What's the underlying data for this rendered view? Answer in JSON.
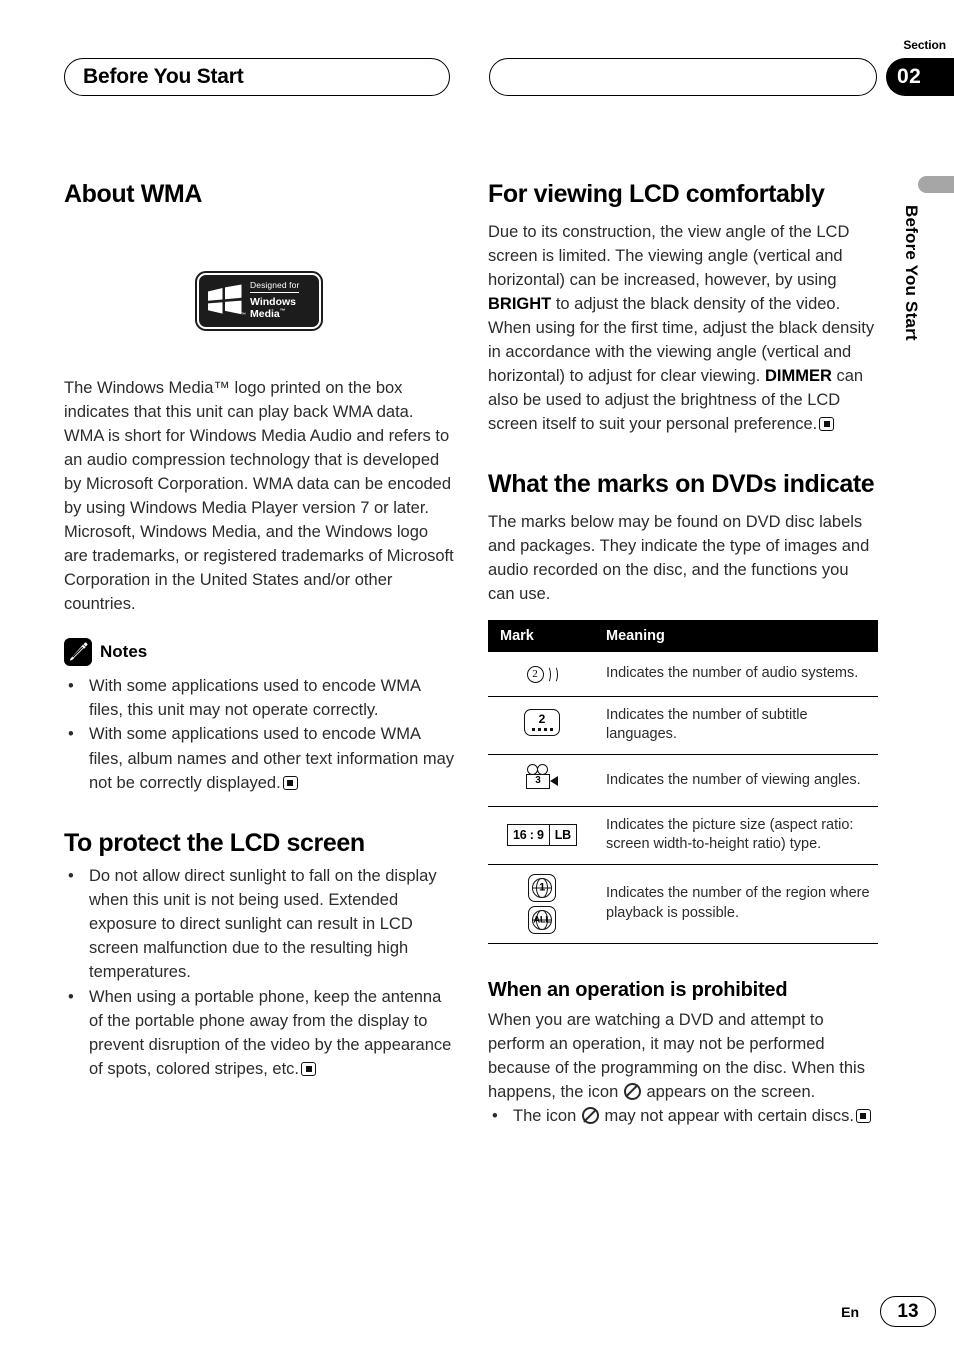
{
  "header": {
    "breadcrumb_title": "Before You Start",
    "section_label": "Section",
    "section_number": "02"
  },
  "sidebar": {
    "vertical_label": "Before You Start"
  },
  "left_column": {
    "about_wma": {
      "heading": "About WMA",
      "logo": {
        "designed_for": "Designed for",
        "line1": "Windows",
        "line2": "Media",
        "tm": "™",
        "flag_tm": "™"
      },
      "paragraphs": [
        "The Windows Media™ logo printed on the box indicates that this unit can play back WMA data.",
        "WMA is short for Windows Media Audio and refers to an audio compression technology that is developed by Microsoft Corporation. WMA data can be encoded by using Windows Media Player version 7 or later.",
        "Microsoft, Windows Media, and the Windows logo are trademarks, or registered trademarks of Microsoft Corporation in the United States and/or other countries."
      ],
      "notes_label": "Notes",
      "notes": [
        "With some applications used to encode WMA files, this unit may not operate correctly.",
        "With some applications used to encode WMA files, album names and other text information may not be correctly displayed."
      ]
    },
    "protect_lcd": {
      "heading": "To protect the LCD screen",
      "bullets": [
        "Do not allow direct sunlight to fall on the display when this unit is not being used. Extended exposure to direct sunlight can result in LCD screen malfunction due to the resulting high temperatures.",
        "When using a portable phone, keep the antenna of the portable phone away from the display to prevent disruption of the video by the appearance of spots, colored stripes, etc."
      ]
    }
  },
  "right_column": {
    "viewing_lcd": {
      "heading": "For viewing LCD comfortably",
      "text_part1": "Due to its construction, the view angle of the LCD screen is limited. The viewing angle (vertical and horizontal) can be increased, however, by using ",
      "keyword1": "BRIGHT",
      "text_part2": " to adjust the black density of the video. When using for the first time, adjust the black density in accordance with the viewing angle (vertical and horizontal) to adjust for clear viewing. ",
      "keyword2": "DIMMER",
      "text_part3": " can also be used to adjust the brightness of the LCD screen itself to suit your personal preference."
    },
    "dvd_marks": {
      "heading": "What the marks on DVDs indicate",
      "intro": "The marks below may be found on DVD disc labels and packages. They indicate the type of images and audio recorded on the disc, and the functions you can use.",
      "table": {
        "columns": [
          "Mark",
          "Meaning"
        ],
        "rows": [
          {
            "icon": "audio-systems-icon",
            "icon_value": "2",
            "meaning": "Indicates the number of audio systems."
          },
          {
            "icon": "subtitle-languages-icon",
            "icon_value": "2",
            "meaning": "Indicates the number of subtitle languages."
          },
          {
            "icon": "viewing-angles-icon",
            "icon_value": "3",
            "meaning": "Indicates the number of viewing angles."
          },
          {
            "icon": "aspect-ratio-icon",
            "icon_value_1": "16 : 9",
            "icon_value_2": "LB",
            "meaning": "Indicates the picture size (aspect ratio: screen width-to-height ratio) type."
          },
          {
            "icon": "region-code-icon",
            "icon_value_1": "1",
            "icon_value_2": "ALL",
            "meaning": "Indicates the number of the region where playback is possible."
          }
        ]
      }
    },
    "prohibited": {
      "heading": "When an operation is prohibited",
      "text_part1": "When you are watching a DVD and attempt to perform an operation, it may not be performed because of the programming on the disc. When this happens, the icon ",
      "text_part2": " appears on the screen.",
      "bullet_part1": "The icon ",
      "bullet_part2": " may not appear with certain discs."
    }
  },
  "footer": {
    "language": "En",
    "page_number": "13"
  }
}
